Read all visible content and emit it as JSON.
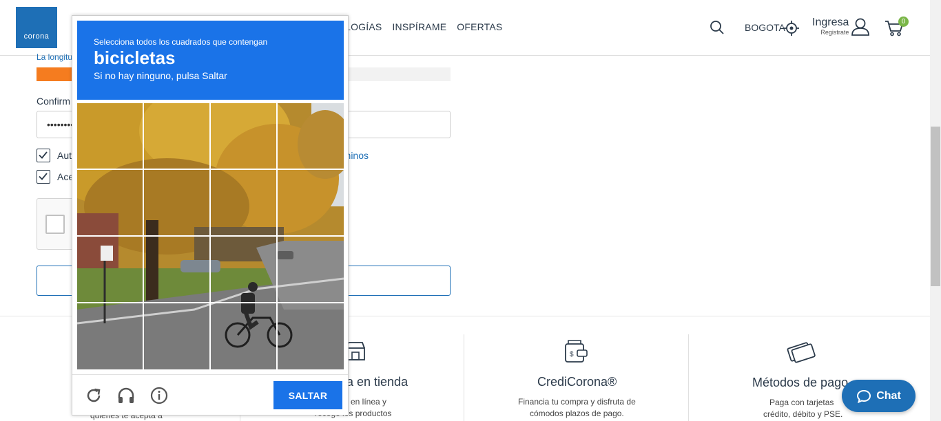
{
  "header": {
    "logo_text": "corona",
    "nav": [
      "OLOGÍAS",
      "INSPÍRAME",
      "OFERTAS"
    ],
    "city": "BOGOTA",
    "login_label": "Ingresa",
    "register_label": "Registrate",
    "cart_count": "0",
    "icons": [
      "search-icon",
      "location-target-icon",
      "user-icon",
      "cart-icon"
    ]
  },
  "form": {
    "hint": "La longitud",
    "confirm_label": "Confirm",
    "password_value": "••••••••",
    "checkbox1_label": "Aut",
    "checkbox2_label": "Ace",
    "terms_link": "rminos",
    "password_strength_level": 0.1
  },
  "captcha": {
    "instruction": "Selecciona todos los cuadrados que contengan",
    "target": "bicicletas",
    "hint": "Si no hay ninguno, pulsa Saltar",
    "grid_size": 4,
    "skip_label": "SALTAR",
    "footer_icons": [
      "reload-icon",
      "audio-headphones-icon",
      "info-icon"
    ]
  },
  "features": [
    {
      "title": "a en tienda",
      "lines": [
        "en línea y",
        "recoge los productos"
      ]
    },
    {
      "title": "CrediCorona®",
      "lines": [
        "Financia tu compra y disfruta de",
        "cómodos plazos de pago."
      ]
    },
    {
      "title": "Métodos de pago",
      "lines": [
        "Paga con tarjetas",
        "crédito, débito y PSE."
      ]
    }
  ],
  "feature_left_partial": "quiénes te acepta a",
  "chat": {
    "label": "Chat"
  },
  "colors": {
    "brand_blue": "#1e6fb6",
    "captcha_blue": "#1a73e8",
    "orange": "#f57c1f",
    "cart_badge": "#7ab648"
  }
}
